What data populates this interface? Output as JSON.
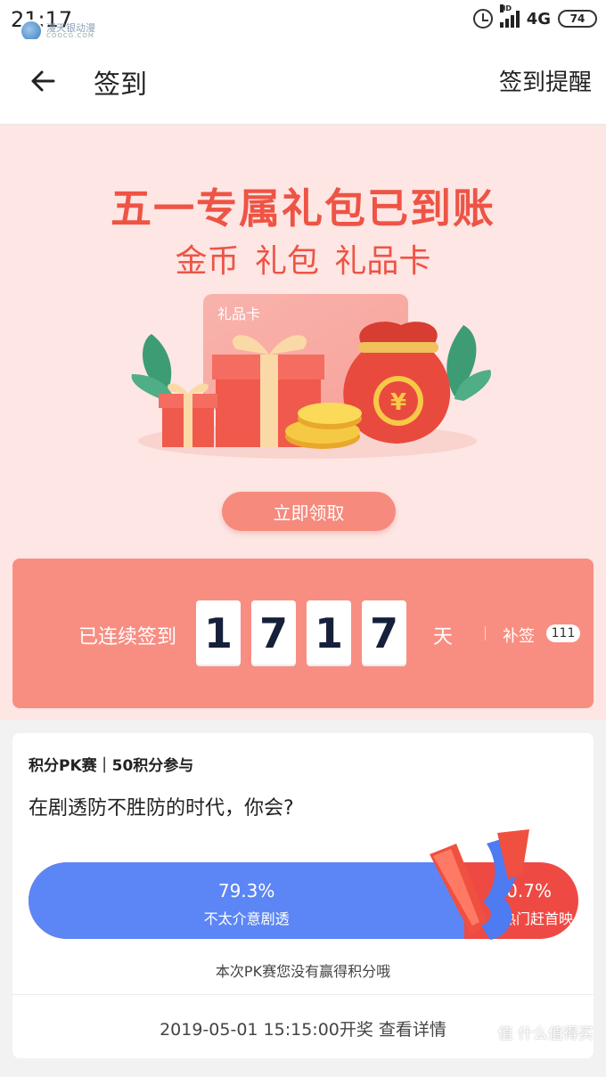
{
  "status_bar": {
    "time": "21:17",
    "watermark_logo_text": "漫天银动漫",
    "watermark_logo_sub": "COOCG.COM",
    "signal_badge": "HD",
    "network": "4G",
    "battery": "74"
  },
  "header": {
    "title": "签到",
    "remind_label": "签到提醒"
  },
  "banner": {
    "title": "五一专属礼包已到账",
    "subtitle": "金币 礼包 礼品卡",
    "card_label": "礼品卡",
    "yen_symbol": "¥",
    "claim_button": "立即领取"
  },
  "streak": {
    "label": "已连续签到",
    "digits": [
      "1",
      "7",
      "1",
      "7"
    ],
    "unit": "天",
    "makeup_label": "补签",
    "makeup_count": "111"
  },
  "pk": {
    "header": "积分PK赛｜50积分参与",
    "question": "在剧透防不胜防的时代，你会?",
    "left": {
      "percent": "79.3%",
      "label": "不太介意剧透",
      "fraction": 0.793,
      "color": "#5c86f6"
    },
    "right": {
      "percent": "20.7%",
      "label": "热门赶首映",
      "color": "#ee4a43"
    },
    "note": "本次PK赛您没有赢得积分哦",
    "footer": "2019-05-01 15:15:00开奖 查看详情"
  },
  "watermark": "值 什么值得买",
  "colors": {
    "accent": "#ee5445",
    "banner_bg": "#fde6e4",
    "streak_bg": "#f88e82"
  }
}
